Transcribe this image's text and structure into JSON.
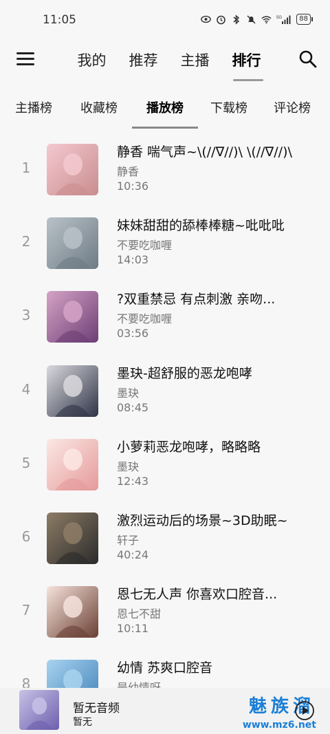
{
  "status_bar": {
    "time": "11:05",
    "network": "5G",
    "battery": "88"
  },
  "nav": {
    "tabs": [
      {
        "label": "我的"
      },
      {
        "label": "推荐"
      },
      {
        "label": "主播"
      },
      {
        "label": "排行",
        "active": true
      }
    ]
  },
  "subtabs": [
    {
      "label": "主播榜"
    },
    {
      "label": "收藏榜"
    },
    {
      "label": "播放榜",
      "active": true
    },
    {
      "label": "下载榜"
    },
    {
      "label": "评论榜"
    }
  ],
  "tracks": [
    {
      "rank": "1",
      "title": "静香 喘气声~\\(//∇//)\\ \\(//∇//)\\",
      "artist": "静香",
      "duration": "10:36",
      "cover_colors": [
        "#f3c9cf",
        "#c98d8f"
      ]
    },
    {
      "rank": "2",
      "title": "妹妹甜甜的舔棒棒糖~吡吡吡",
      "artist": "不要吃咖喱",
      "duration": "14:03",
      "cover_colors": [
        "#b9c2c8",
        "#6e7b85"
      ]
    },
    {
      "rank": "3",
      "title": "?双重禁忌 有点刺激 亲吻...",
      "artist": "不要吃咖喱",
      "duration": "03:56",
      "cover_colors": [
        "#d5a3c6",
        "#6d3e75"
      ]
    },
    {
      "rank": "4",
      "title": "墨玦-超舒服的恶龙咆哮",
      "artist": "墨玦",
      "duration": "08:45",
      "cover_colors": [
        "#d9d9dd",
        "#2f3346"
      ]
    },
    {
      "rank": "5",
      "title": "小萝莉恶龙咆哮，略略略",
      "artist": "墨玦",
      "duration": "12:43",
      "cover_colors": [
        "#fbe8e4",
        "#e59a9a"
      ]
    },
    {
      "rank": "6",
      "title": "激烈运动后的场景~3D助眠~",
      "artist": "轩子",
      "duration": "40:24",
      "cover_colors": [
        "#8d7c66",
        "#2b2b2b"
      ]
    },
    {
      "rank": "7",
      "title": "恩七无人声 你喜欢口腔音...",
      "artist": "恩七不甜",
      "duration": "10:11",
      "cover_colors": [
        "#f6e3dc",
        "#6a3f33"
      ]
    },
    {
      "rank": "8",
      "title": "幼情 苏爽口腔音",
      "artist": "是幼情呀",
      "duration": "",
      "cover_colors": [
        "#a8d3ef",
        "#3f7fb8"
      ]
    }
  ],
  "player": {
    "title": "暂无音频",
    "subtitle": "暂无",
    "cover_colors": [
      "#c7c2e6",
      "#6e5fae"
    ]
  },
  "watermark": {
    "brand": "魅族溜",
    "url": "www.mz6.net"
  }
}
